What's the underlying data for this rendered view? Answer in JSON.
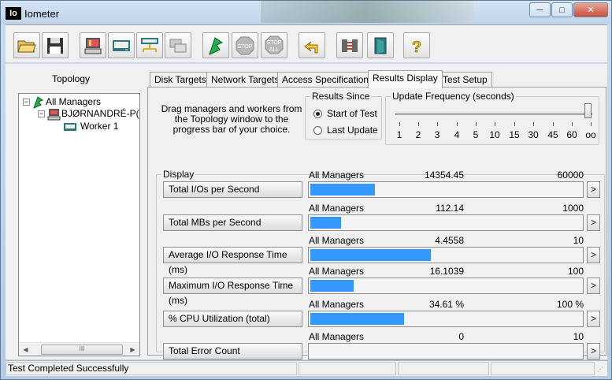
{
  "window": {
    "title": "Iometer",
    "logo": "Io",
    "minimize": "─",
    "maximize": "□",
    "close": "✕"
  },
  "toolbar": [
    {
      "name": "open-button",
      "icon": "folder-open-icon"
    },
    {
      "name": "save-button",
      "icon": "floppy-disk-icon"
    },
    {
      "name": "start-new-manager-button",
      "icon": "computer-icon"
    },
    {
      "name": "start-disk-worker-button",
      "icon": "disk-worker-icon"
    },
    {
      "name": "start-network-worker-button",
      "icon": "network-worker-icon"
    },
    {
      "name": "duplicate-worker-button",
      "icon": "duplicate-icon"
    },
    {
      "name": "start-tests-button",
      "icon": "green-flag-icon"
    },
    {
      "name": "stop-button",
      "icon": "stop-sign-icon",
      "label": "STOP"
    },
    {
      "name": "stop-all-button",
      "icon": "stop-all-icon",
      "label": "STOP",
      "sublabel": "ALL"
    },
    {
      "name": "reset-workers-button",
      "icon": "reset-arrow-icon"
    },
    {
      "name": "disconnect-button",
      "icon": "disconnect-icon"
    },
    {
      "name": "exit-button",
      "icon": "exit-door-icon"
    },
    {
      "name": "help-button",
      "icon": "help-icon",
      "label": "?"
    }
  ],
  "topology": {
    "title": "Topology",
    "root": "All Managers",
    "manager": "BJØRNANDRÉ-P(",
    "worker": "Worker 1",
    "scroll_thumb": "III"
  },
  "tabs": [
    "Disk Targets",
    "Network Targets",
    "Access Specifications",
    "Results Display",
    "Test Setup"
  ],
  "active_tab": "Results Display",
  "results": {
    "drag_text": "Drag managers and workers from the Topology window to the progress bar of your choice.",
    "results_since": {
      "title": "Results Since",
      "options": [
        "Start of Test",
        "Last Update"
      ],
      "selected": "Start of Test"
    },
    "update_frequency": {
      "title": "Update Frequency (seconds)",
      "ticks": [
        "1",
        "2",
        "3",
        "4",
        "5",
        "10",
        "15",
        "30",
        "45",
        "60",
        "oo"
      ],
      "selected": "oo"
    },
    "display_title": "Display",
    "metrics": [
      {
        "label": "Total I/Os per Second",
        "source": "All Managers",
        "value": "14354.45",
        "max": "60000",
        "fraction": 0.239
      },
      {
        "label": "Total MBs per Second",
        "source": "All Managers",
        "value": "112.14",
        "max": "1000",
        "fraction": 0.112
      },
      {
        "label": "Average I/O Response Time (ms)",
        "source": "All Managers",
        "value": "4.4558",
        "max": "10",
        "fraction": 0.4456
      },
      {
        "label": "Maximum I/O Response Time (ms)",
        "source": "All Managers",
        "value": "16.1039",
        "max": "100",
        "fraction": 0.161
      },
      {
        "label": "% CPU Utilization (total)",
        "source": "All Managers",
        "value": "34.61 %",
        "max": "100 %",
        "fraction": 0.3461
      },
      {
        "label": "Total Error Count",
        "source": "All Managers",
        "value": "0",
        "max": "10",
        "fraction": 0
      }
    ],
    "arrow": ">"
  },
  "status": {
    "message": "Test Completed Successfully",
    "grip": "⋰"
  },
  "colors": {
    "bar": "#3399ff",
    "frame": "#bcd3ea"
  }
}
